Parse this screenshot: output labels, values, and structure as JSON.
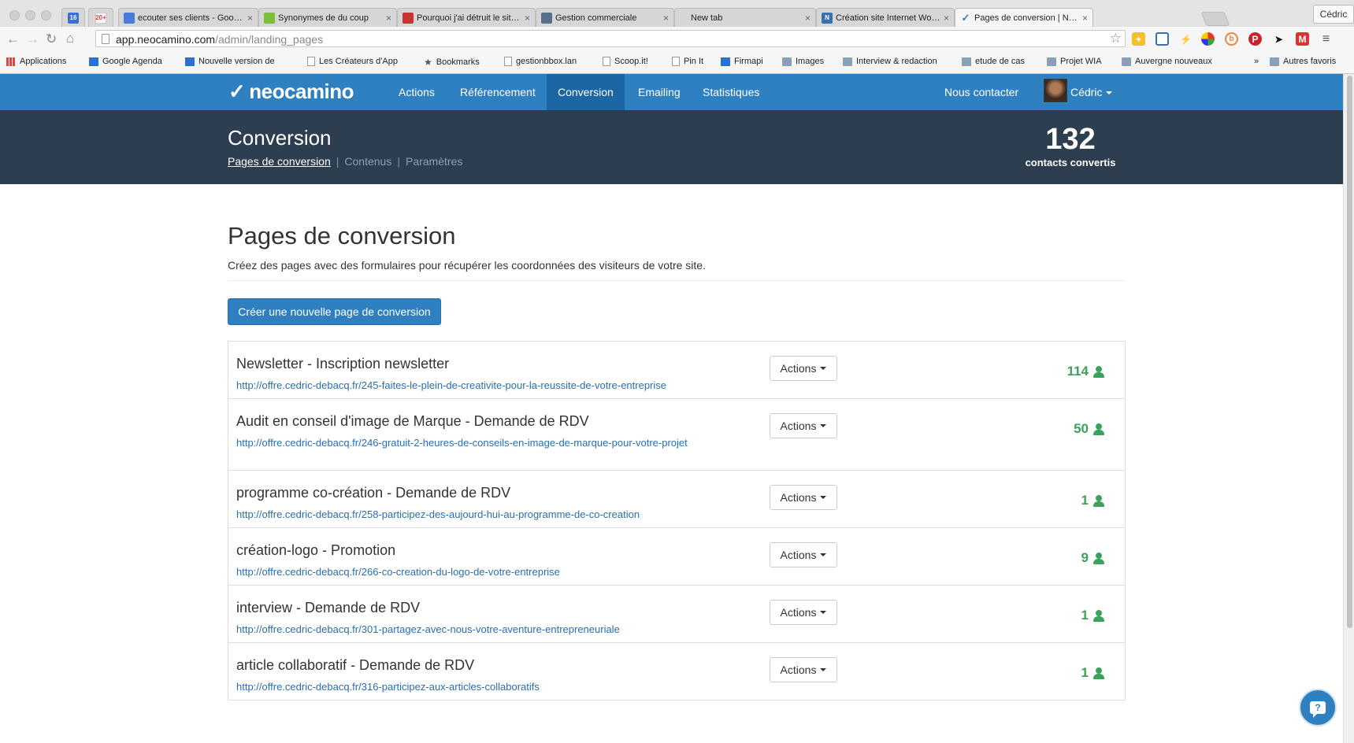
{
  "browser": {
    "tabs": [
      {
        "title": "16",
        "favicon_color": "#3b6fd4",
        "pinned": true
      },
      {
        "title": "20+",
        "favicon_color": "#d44",
        "pinned": true
      },
      {
        "title": "ecouter ses clients - Google",
        "favicon_color": "#4a7bd9"
      },
      {
        "title": "Synonymes de du coup",
        "favicon_color": "#7cbf3a"
      },
      {
        "title": "Pourquoi j'ai détruit le site w",
        "favicon_color": "#c33"
      },
      {
        "title": "Gestion commerciale",
        "favicon_color": "#58708a"
      },
      {
        "title": "New tab",
        "favicon_color": ""
      },
      {
        "title": "Création site Internet Wordp",
        "favicon_color": "#3a6fb0"
      },
      {
        "title": "Pages de conversion | Neoc",
        "favicon_color": "#2f80c0"
      }
    ],
    "profile_name": "Cédric",
    "url_host": "app.neocamino.com",
    "url_path": "/admin/landing_pages",
    "bookmarks": [
      {
        "label": "Applications",
        "icon": "apps-icon"
      },
      {
        "label": "Google Agenda",
        "icon": "calendar-icon"
      },
      {
        "label": "Nouvelle version de",
        "icon": "contacts-icon"
      },
      {
        "label": "Les Créateurs d'App",
        "icon": "page-icon"
      },
      {
        "label": "Bookmarks",
        "icon": "star-icon"
      },
      {
        "label": "gestionbbox.lan",
        "icon": "page-icon"
      },
      {
        "label": "Scoop.it!",
        "icon": "page-icon"
      },
      {
        "label": "Pin It",
        "icon": "page-icon"
      },
      {
        "label": "Firmapi",
        "icon": "bars-icon"
      },
      {
        "label": "Images",
        "icon": "folder-icon"
      },
      {
        "label": "Interview & redaction",
        "icon": "folder-icon"
      },
      {
        "label": "etude de cas",
        "icon": "folder-icon"
      },
      {
        "label": "Projet WIA",
        "icon": "folder-icon"
      },
      {
        "label": "Auvergne nouveaux",
        "icon": "folder-icon"
      },
      {
        "label": "»",
        "icon": ""
      },
      {
        "label": "Autres favoris",
        "icon": "folder-icon"
      }
    ]
  },
  "app": {
    "brand": "neocamino",
    "nav": [
      {
        "label": "Actions",
        "active": false
      },
      {
        "label": "Référencement",
        "active": false
      },
      {
        "label": "Conversion",
        "active": true
      },
      {
        "label": "Emailing",
        "active": false
      },
      {
        "label": "Statistiques",
        "active": false
      }
    ],
    "contact_label": "Nous contacter",
    "user_name": "Cédric",
    "section_title": "Conversion",
    "subnav": [
      {
        "label": "Pages de conversion",
        "current": true
      },
      {
        "label": "Contenus",
        "current": false
      },
      {
        "label": "Paramètres",
        "current": false
      }
    ],
    "stat_value": "132",
    "stat_label": "contacts convertis",
    "page_title": "Pages de conversion",
    "page_description": "Créez des pages avec des formulaires pour récupérer les coordonnées des visiteurs de votre site.",
    "create_button": "Créer une nouvelle page de conversion",
    "actions_label": "Actions",
    "pages": [
      {
        "name": "Newsletter - Inscription newsletter",
        "url": "http://offre.cedric-debacq.fr/245-faites-le-plein-de-creativite-pour-la-reussite-de-votre-entreprise",
        "count": "114"
      },
      {
        "name": "Audit en conseil d'image de Marque - Demande de RDV",
        "url": "http://offre.cedric-debacq.fr/246-gratuit-2-heures-de-conseils-en-image-de-marque-pour-votre-projet",
        "count": "50"
      },
      {
        "name": "programme co-création - Demande de RDV",
        "url": "http://offre.cedric-debacq.fr/258-participez-des-aujourd-hui-au-programme-de-co-creation",
        "count": "1"
      },
      {
        "name": "création-logo - Promotion",
        "url": "http://offre.cedric-debacq.fr/266-co-creation-du-logo-de-votre-entreprise",
        "count": "9"
      },
      {
        "name": "interview - Demande de RDV",
        "url": "http://offre.cedric-debacq.fr/301-partagez-avec-nous-votre-aventure-entrepreneuriale",
        "count": "1"
      },
      {
        "name": "article collaboratif - Demande de RDV",
        "url": "http://offre.cedric-debacq.fr/316-participez-aux-articles-collaboratifs",
        "count": "1"
      }
    ],
    "colors": {
      "primary": "#2f80c0",
      "header_dark": "#2d3e50",
      "count_green": "#3aa25a",
      "link": "#2a6eb0"
    }
  }
}
